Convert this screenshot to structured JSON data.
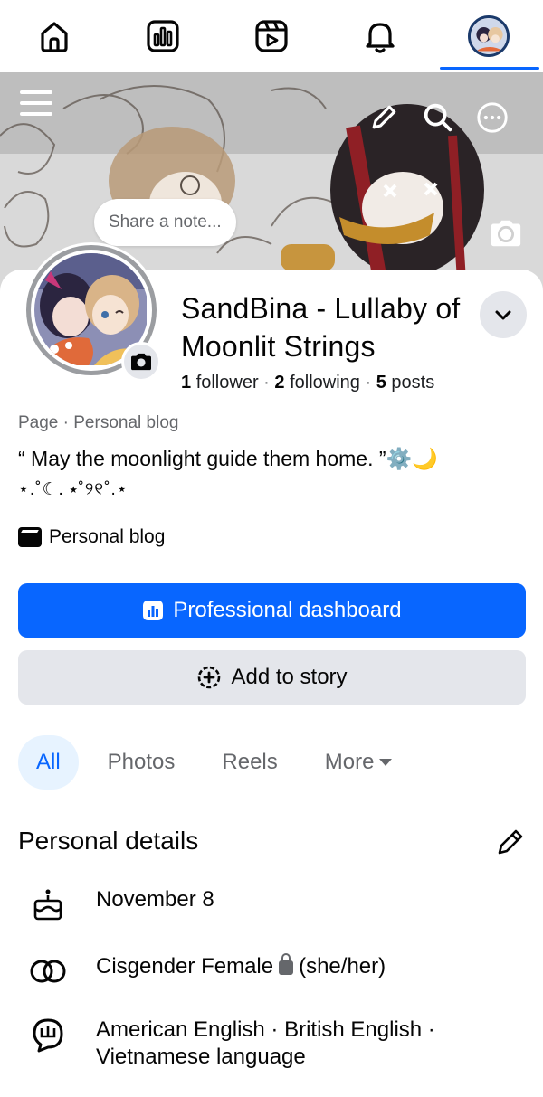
{
  "nav": {
    "items": [
      {
        "name": "home-icon"
      },
      {
        "name": "dashboard-icon"
      },
      {
        "name": "reels-icon"
      },
      {
        "name": "bell-icon"
      },
      {
        "name": "profile-avatar-icon"
      }
    ],
    "active_index": 4,
    "accent": "#0866ff"
  },
  "cover": {
    "icons": [
      "menu-icon",
      "pencil-icon",
      "search-icon",
      "more-icon",
      "camera-icon"
    ]
  },
  "note": {
    "placeholder": "Share a note..."
  },
  "profile": {
    "name": "SandBina - Lullaby of Moonlit Strings",
    "followers_count": "1",
    "followers_label": "follower",
    "following_count": "2",
    "following_label": "following",
    "posts_count": "5",
    "posts_label": "posts",
    "separator": "·",
    "page_type": "Page · Personal blog",
    "bio_line1": "“ May the moonlight guide them home. ”⚙️🌙",
    "bio_line2": "⋆.˚☾. ⭑˚୨୧˚.⋆",
    "category": "Personal blog"
  },
  "buttons": {
    "primary_label": "Professional dashboard",
    "secondary_label": "Add to story"
  },
  "tabs": [
    {
      "label": "All",
      "active": true
    },
    {
      "label": "Photos",
      "active": false
    },
    {
      "label": "Reels",
      "active": false
    },
    {
      "label": "More",
      "active": false
    }
  ],
  "details": {
    "title": "Personal details",
    "birthday": "November 8",
    "gender": "Cisgender Female",
    "pronouns": "(she/her)",
    "languages_line1": "American English · British English ·",
    "languages_line2": "Vietnamese language"
  }
}
